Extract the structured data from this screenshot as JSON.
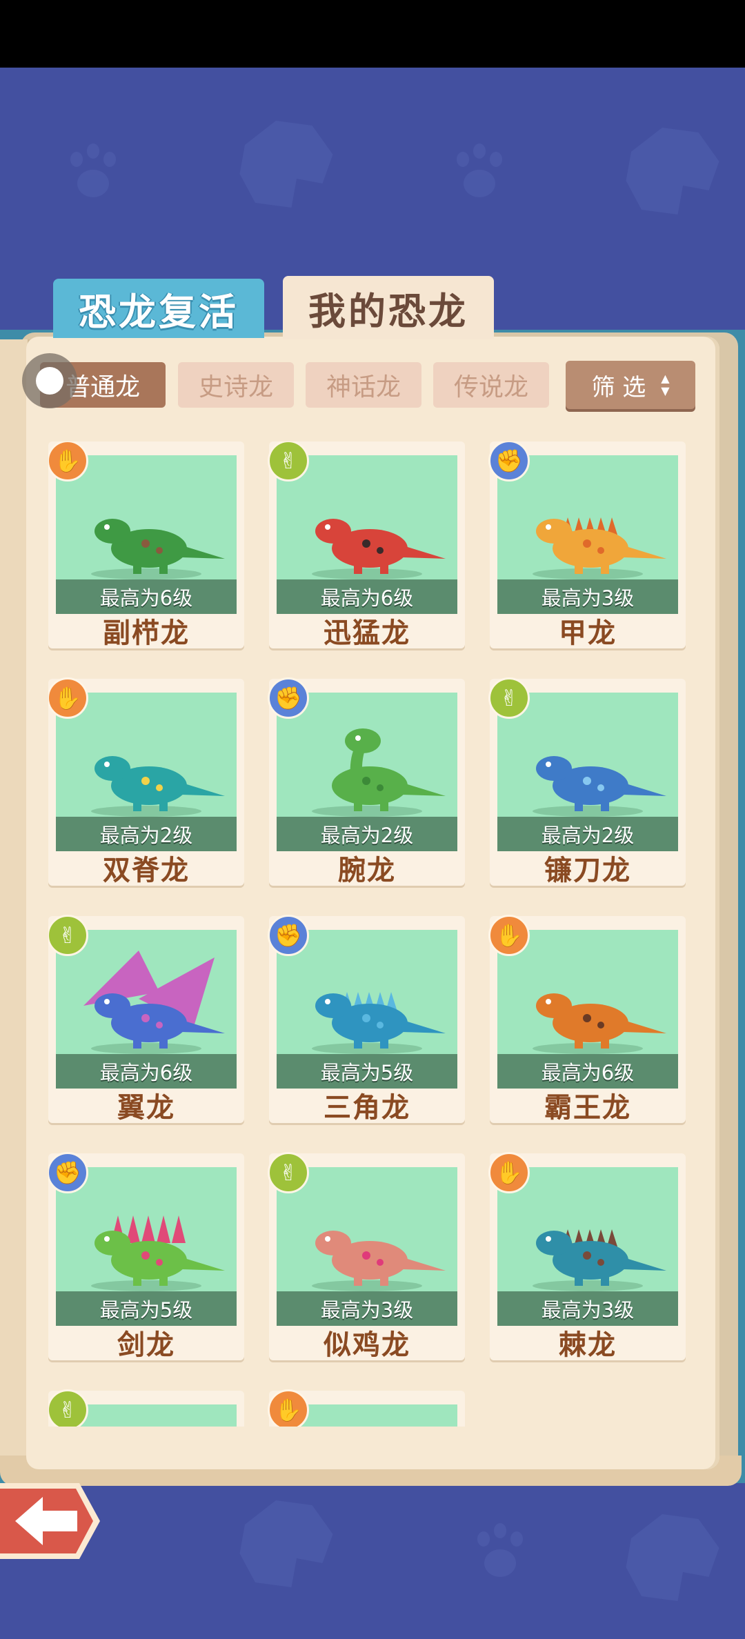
{
  "tabs": {
    "revive": "恐龙复活",
    "mine": "我的恐龙"
  },
  "filters": [
    "普通龙",
    "史诗龙",
    "神话龙",
    "传说龙"
  ],
  "filter_button": {
    "label": "筛 选"
  },
  "cards": [
    {
      "name": "副栉龙",
      "level": "最高为6级",
      "hand": "paper",
      "color": "#f08a3c"
    },
    {
      "name": "迅猛龙",
      "level": "最高为6级",
      "hand": "scissors",
      "color": "#9ec23a"
    },
    {
      "name": "甲龙",
      "level": "最高为3级",
      "hand": "rock",
      "color": "#5a82d8"
    },
    {
      "name": "双脊龙",
      "level": "最高为2级",
      "hand": "paper",
      "color": "#f08a3c"
    },
    {
      "name": "腕龙",
      "level": "最高为2级",
      "hand": "rock",
      "color": "#5a82d8"
    },
    {
      "name": "镰刀龙",
      "level": "最高为2级",
      "hand": "scissors",
      "color": "#9ec23a"
    },
    {
      "name": "翼龙",
      "level": "最高为6级",
      "hand": "scissors",
      "color": "#9ec23a"
    },
    {
      "name": "三角龙",
      "level": "最高为5级",
      "hand": "rock",
      "color": "#5a82d8"
    },
    {
      "name": "霸王龙",
      "level": "最高为6级",
      "hand": "paper",
      "color": "#f08a3c"
    },
    {
      "name": "剑龙",
      "level": "最高为5级",
      "hand": "rock",
      "color": "#5a82d8"
    },
    {
      "name": "似鸡龙",
      "level": "最高为3级",
      "hand": "scissors",
      "color": "#9ec23a"
    },
    {
      "name": "棘龙",
      "level": "最高为3级",
      "hand": "paper",
      "color": "#f08a3c"
    }
  ],
  "partial_cards": [
    {
      "hand": "scissors",
      "color": "#9ec23a"
    },
    {
      "hand": "paper",
      "color": "#f08a3c"
    }
  ],
  "icons": {
    "back": "back-arrow-icon",
    "sort": "sort-arrows-icon"
  }
}
